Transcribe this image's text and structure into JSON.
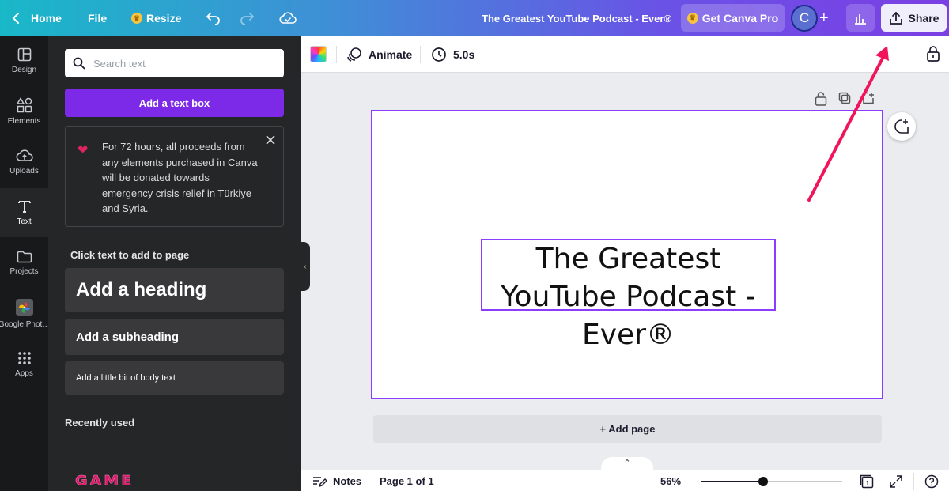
{
  "topbar": {
    "home_label": "Home",
    "file_label": "File",
    "resize_label": "Resize",
    "design_title": "The Greatest YouTube Podcast - Ever®",
    "get_pro_label": "Get Canva Pro",
    "avatar_initial": "C",
    "share_label": "Share"
  },
  "rail": {
    "items": [
      {
        "label": "Design",
        "icon": "layout-icon"
      },
      {
        "label": "Elements",
        "icon": "shapes-icon"
      },
      {
        "label": "Uploads",
        "icon": "cloud-upload-icon"
      },
      {
        "label": "Text",
        "icon": "text-icon"
      },
      {
        "label": "Projects",
        "icon": "folder-icon"
      },
      {
        "label": "Google Phot…",
        "icon": "google-photos-icon"
      },
      {
        "label": "Apps",
        "icon": "apps-grid-icon"
      }
    ]
  },
  "panel": {
    "search_placeholder": "Search text",
    "add_textbox_label": "Add a text box",
    "notice_text": "For 72 hours, all proceeds from any elements purchased in Canva will be donated towards emergency crisis relief in Türkiye and Syria.",
    "click_text_label": "Click text to add to page",
    "heading_label": "Add a heading",
    "subheading_label": "Add a subheading",
    "body_label": "Add a little bit of body text",
    "recently_used_label": "Recently used",
    "recent_item_label": "GAME"
  },
  "editor": {
    "animate_label": "Animate",
    "duration_label": "5.0s",
    "canvas_text": "The Greatest YouTube Podcast - Ever®",
    "add_page_label": "+ Add page"
  },
  "bottombar": {
    "notes_label": "Notes",
    "page_indicator": "Page 1 of 1",
    "zoom_label": "56%",
    "zoom_fraction": 0.44,
    "page_count": "1"
  },
  "colors": {
    "accent": "#7d2ae8",
    "selection": "#8b3dff",
    "annotation_arrow": "#f0145a"
  }
}
